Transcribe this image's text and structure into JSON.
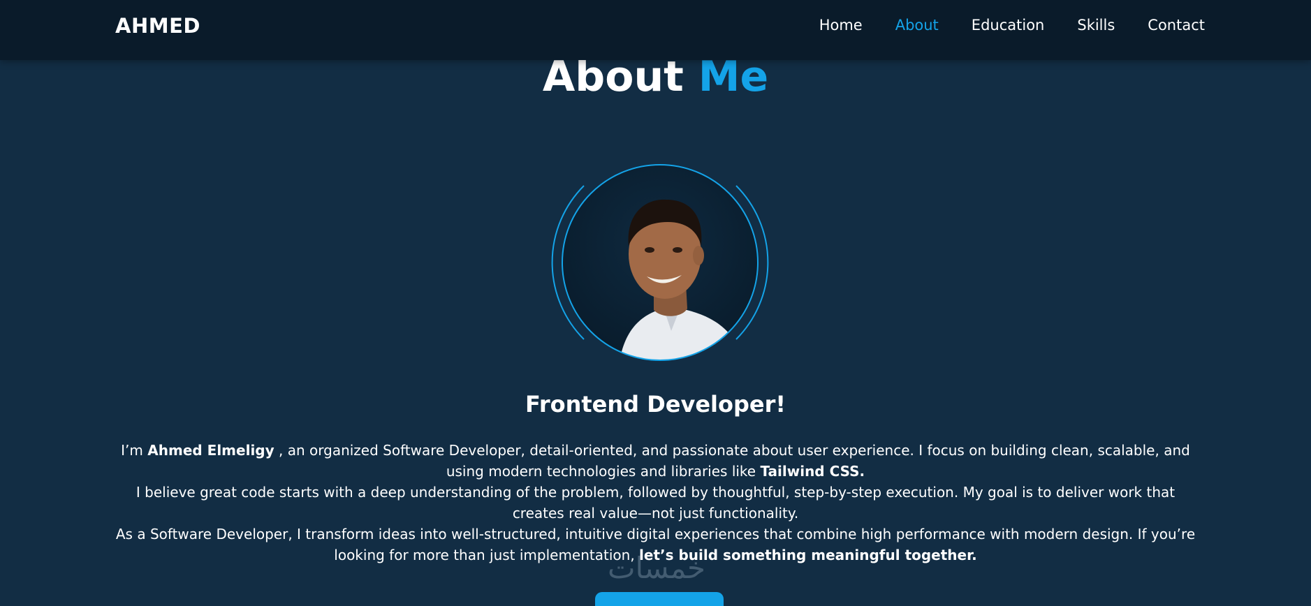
{
  "nav": {
    "logo": "AHMED",
    "links": [
      "Home",
      "About",
      "Education",
      "Skills",
      "Contact"
    ],
    "active": "About"
  },
  "title": {
    "part1": "About",
    "part2": "Me"
  },
  "subtitle": "Frontend Developer!",
  "bio": {
    "p1_pre": "I’m ",
    "p1_name": "Ahmed Elmeligy",
    "p1_mid": " , an organized Software Developer, detail-oriented, and passionate about user experience. I focus on building clean, scalable, and using modern technologies and libraries like ",
    "p1_tech": "Tailwind CSS.",
    "p2": "I believe great code starts with a deep understanding of the problem, followed by thoughtful, step-by-step execution. My goal is to deliver work that creates real value—not just functionality.",
    "p3_pre": "As a Software Developer, I transform ideas into well-structured, intuitive digital experiences that combine high performance with modern design. If you’re looking for more than just implementation, ",
    "p3_bold": "let’s build something meaningful together."
  },
  "watermark": "خمسات",
  "colors": {
    "accent": "#14a3e8",
    "background": "#122d44",
    "navbar": "#0a1b2a"
  }
}
